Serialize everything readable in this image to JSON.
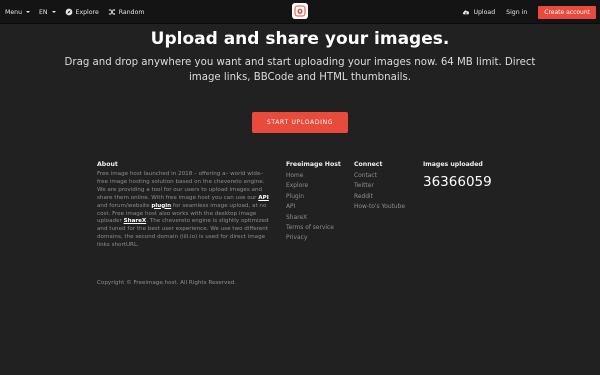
{
  "topbar": {
    "menu_label": "Menu",
    "lang_label": "EN",
    "explore_label": "Explore",
    "random_label": "Random",
    "upload_label": "Upload",
    "signin_label": "Sign in",
    "create_label": "Create account"
  },
  "hero": {
    "title": "Upload and share your images.",
    "subtitle": "Drag and drop anywhere you want and start uploading your images now. 64 MB limit. Direct image links, BBCode and HTML thumbnails.",
    "cta_label": "START UPLOADING"
  },
  "about": {
    "title": "About",
    "p1": "Free image host launched in 2018 – offering a– world wide– free image hosting solution based on the chevereto engine. We are providing a tool for our users to upload images and share them online. With free image host you can use our ",
    "api_link": "API",
    "p2": " and forum/website ",
    "plugin_link": "plugin",
    "p3": " for seamless image upload, at no cost. Free image host also works with the desktop image uploader ",
    "sharex_link": "ShareX",
    "p4": ". The chevereto engine is slightly optimized and tuned for the best user experience. We use two different domains, the second domain (iili.io) is used for direct image links shortURL."
  },
  "freeimage_host": {
    "title": "Freeimage Host",
    "links": [
      "Home",
      "Explore",
      "Plugin",
      "API",
      "ShareX",
      "Terms of service",
      "Privacy"
    ]
  },
  "connect": {
    "title": "Connect",
    "links": [
      "Contact",
      "Twitter",
      "Reddit",
      "How-to's Youtube"
    ]
  },
  "stats": {
    "title": "Images uploaded",
    "count": "36366059"
  },
  "copyright": "Copyright © Freeimage.host. All Rights Reserved.",
  "colors": {
    "background": "#212121",
    "topbar": "#141414",
    "accent": "#e84a3c"
  }
}
